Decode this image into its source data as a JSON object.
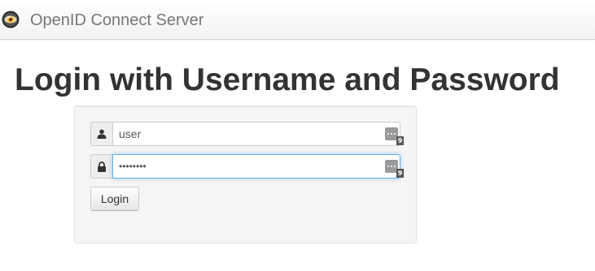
{
  "navbar": {
    "brand_text": "OpenID Connect Server",
    "logo_icon": "openid-logo-icon"
  },
  "page": {
    "title": "Login with Username and Password"
  },
  "login_form": {
    "username": {
      "icon": "user-icon",
      "value": "user",
      "password_manager_icon": "password-manager-icon",
      "password_manager_count": "9"
    },
    "password": {
      "icon": "lock-icon",
      "masked_value": "••••••••",
      "password_manager_icon": "password-manager-icon",
      "password_manager_count": "9"
    },
    "submit_label": "Login"
  },
  "colors": {
    "focus_border": "#66afe9",
    "well_background": "#f5f5f5",
    "title": "#333333",
    "brand": "#777777"
  }
}
